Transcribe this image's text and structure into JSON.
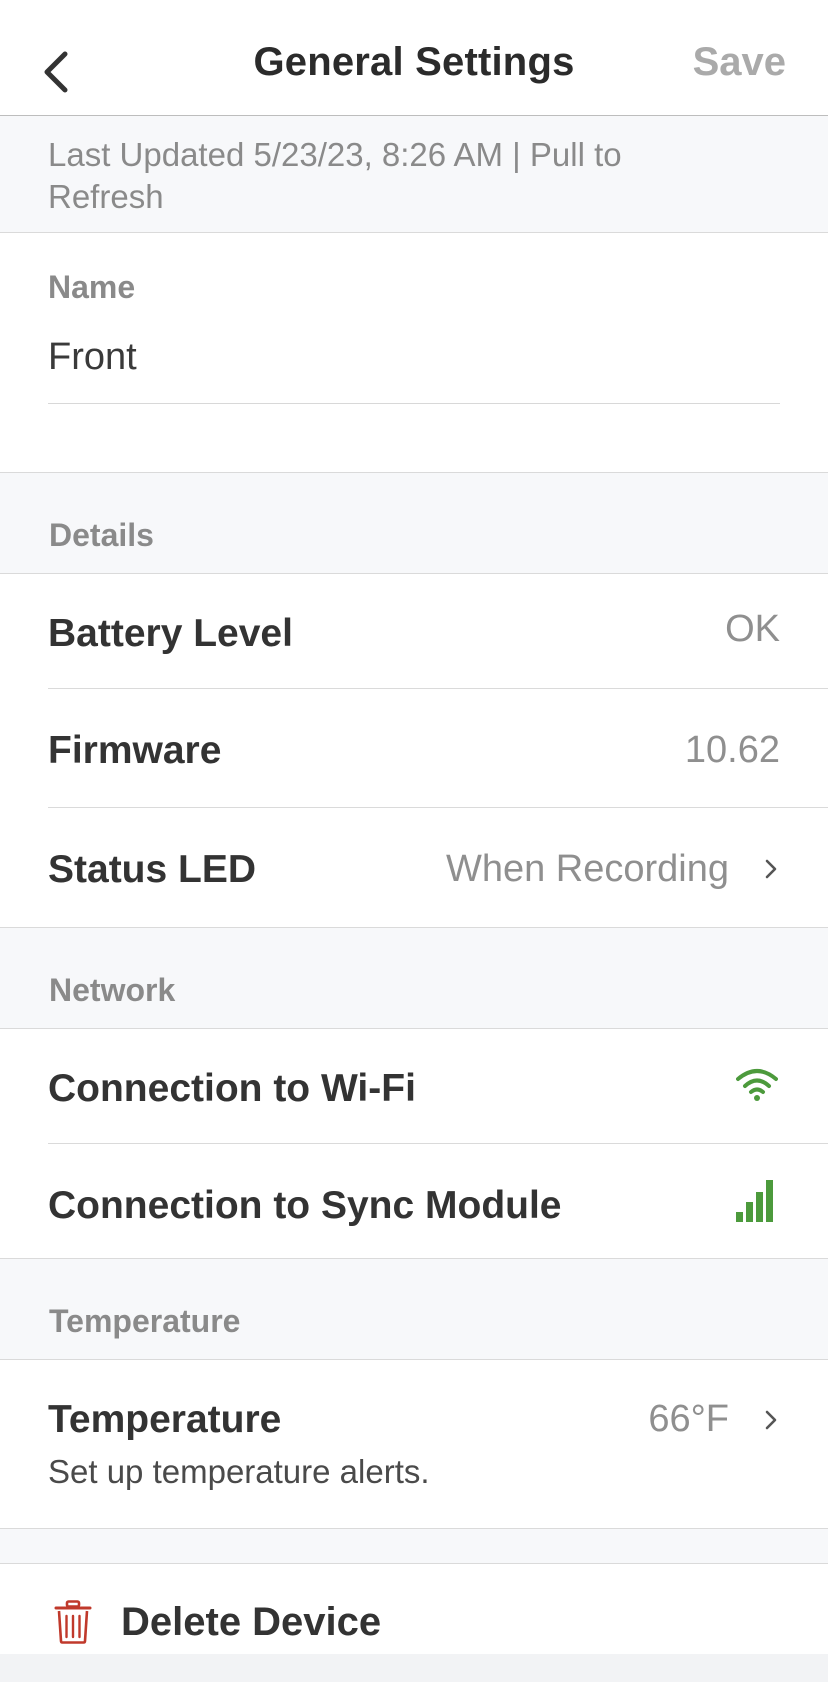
{
  "header": {
    "title": "General Settings",
    "save_label": "Save"
  },
  "status": {
    "last_updated": "Last Updated 5/23/23, 8:26 AM | Pull to Refresh"
  },
  "name_field": {
    "label": "Name",
    "value": "Front"
  },
  "details": {
    "section_title": "Details",
    "battery": {
      "label": "Battery Level",
      "value": "OK"
    },
    "firmware": {
      "label": "Firmware",
      "value": "10.62"
    },
    "status_led": {
      "label": "Status LED",
      "value": "When Recording"
    }
  },
  "network": {
    "section_title": "Network",
    "wifi": {
      "label": "Connection to Wi-Fi",
      "icon": "wifi-signal-icon",
      "color": "#4c9a3c"
    },
    "sync": {
      "label": "Connection to Sync Module",
      "icon": "signal-bars-icon",
      "color": "#4c9a3c"
    }
  },
  "temperature": {
    "section_title": "Temperature",
    "row": {
      "label": "Temperature",
      "value": "66°F",
      "description": "Set up temperature alerts."
    }
  },
  "delete": {
    "label": "Delete Device",
    "icon": "trash-icon",
    "color": "#c0392b"
  }
}
